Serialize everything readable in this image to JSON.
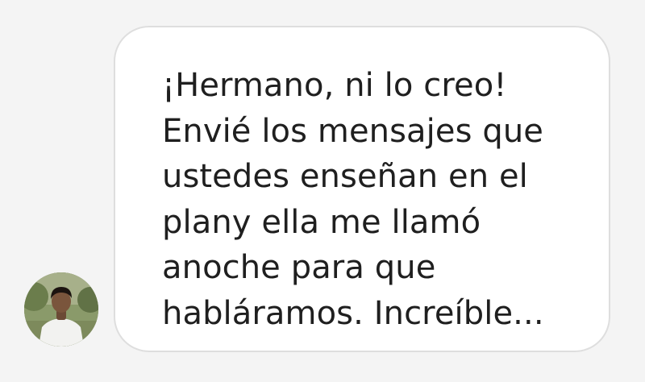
{
  "conversation": {
    "message": {
      "lines": [
        "¡Hermano, ni lo creo!",
        "Envié los mensajes que",
        "ustedes enseñan en el",
        "plany ella me llamó",
        "anoche para que",
        "habláramos. Increíble..."
      ]
    },
    "sender_avatar": {
      "icon": "user-avatar"
    }
  },
  "colors": {
    "background": "#f4f4f4",
    "bubble": "#ffffff",
    "bubble_border": "#dedede",
    "text": "#1f1f1f"
  }
}
